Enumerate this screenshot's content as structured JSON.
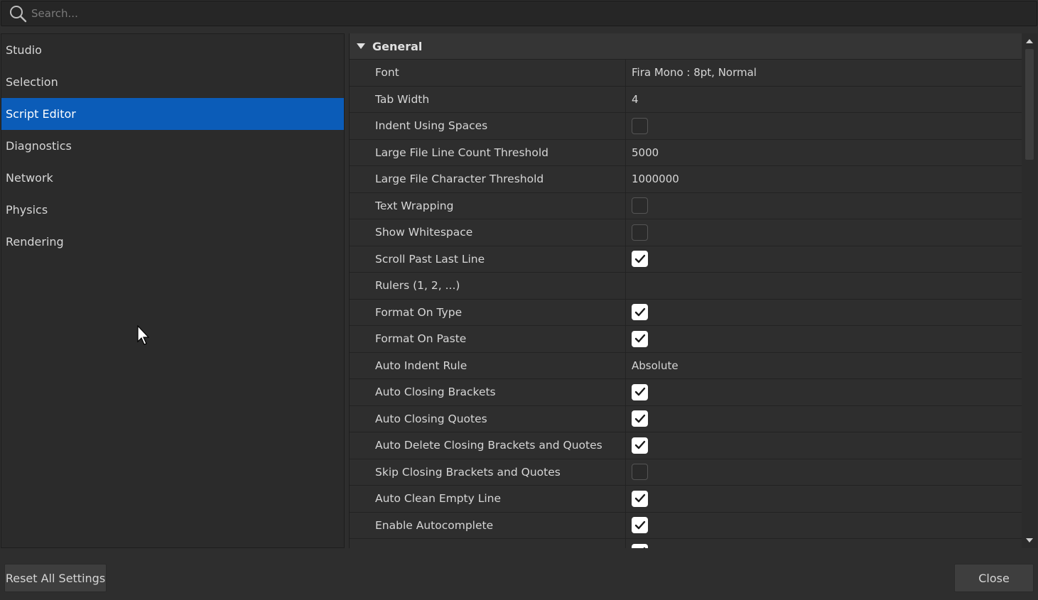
{
  "search": {
    "placeholder": "Search...",
    "value": ""
  },
  "sidebar": {
    "items": [
      {
        "label": "Studio",
        "selected": false
      },
      {
        "label": "Selection",
        "selected": false
      },
      {
        "label": "Script Editor",
        "selected": true
      },
      {
        "label": "Diagnostics",
        "selected": false
      },
      {
        "label": "Network",
        "selected": false
      },
      {
        "label": "Physics",
        "selected": false
      },
      {
        "label": "Rendering",
        "selected": false
      }
    ]
  },
  "section": {
    "title": "General",
    "rows": [
      {
        "label": "Font",
        "type": "text",
        "value": "Fira Mono : 8pt, Normal"
      },
      {
        "label": "Tab Width",
        "type": "text",
        "value": "4"
      },
      {
        "label": "Indent Using Spaces",
        "type": "checkbox",
        "checked": false
      },
      {
        "label": "Large File Line Count Threshold",
        "type": "text",
        "value": "5000"
      },
      {
        "label": "Large File Character Threshold",
        "type": "text",
        "value": "1000000"
      },
      {
        "label": "Text Wrapping",
        "type": "checkbox",
        "checked": false
      },
      {
        "label": "Show Whitespace",
        "type": "checkbox",
        "checked": false
      },
      {
        "label": "Scroll Past Last Line",
        "type": "checkbox",
        "checked": true
      },
      {
        "label": "Rulers (1, 2, ...)",
        "type": "text",
        "value": ""
      },
      {
        "label": "Format On Type",
        "type": "checkbox",
        "checked": true
      },
      {
        "label": "Format On Paste",
        "type": "checkbox",
        "checked": true
      },
      {
        "label": "Auto Indent Rule",
        "type": "text",
        "value": "Absolute"
      },
      {
        "label": "Auto Closing Brackets",
        "type": "checkbox",
        "checked": true
      },
      {
        "label": "Auto Closing Quotes",
        "type": "checkbox",
        "checked": true
      },
      {
        "label": "Auto Delete Closing Brackets and Quotes",
        "type": "checkbox",
        "checked": true
      },
      {
        "label": "Skip Closing Brackets and Quotes",
        "type": "checkbox",
        "checked": false
      },
      {
        "label": "Auto Clean Empty Line",
        "type": "checkbox",
        "checked": true
      },
      {
        "label": "Enable Autocomplete",
        "type": "checkbox",
        "checked": true
      },
      {
        "label": "",
        "type": "checkbox",
        "checked": true
      }
    ]
  },
  "footer": {
    "reset_label": "Reset All Settings",
    "close_label": "Close"
  },
  "colors": {
    "accent": "#0b5cb8",
    "background": "#2e2e2e",
    "text": "#d6d6d6"
  }
}
